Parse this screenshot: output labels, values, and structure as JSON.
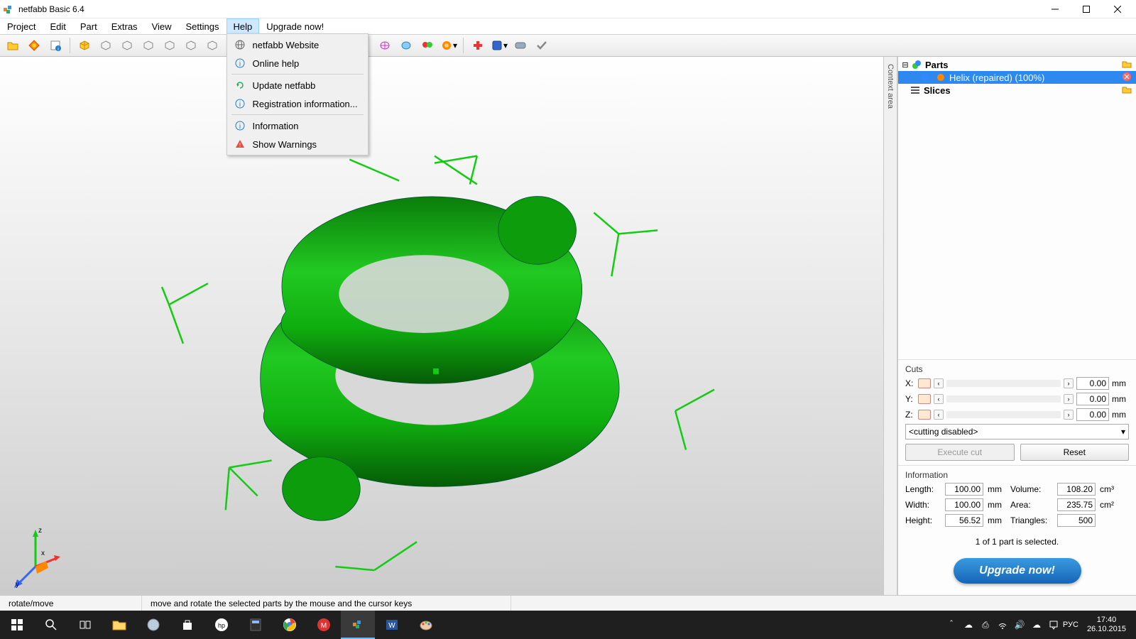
{
  "title": "netfabb Basic 6.4",
  "menus": [
    "Project",
    "Edit",
    "Part",
    "Extras",
    "View",
    "Settings",
    "Help",
    "Upgrade now!"
  ],
  "help_menu": [
    {
      "icon": "globe",
      "label": "netfabb Website"
    },
    {
      "icon": "info",
      "label": "Online help"
    },
    {
      "sep": true
    },
    {
      "icon": "refresh",
      "label": "Update netfabb"
    },
    {
      "icon": "info",
      "label": "Registration information..."
    },
    {
      "sep": true
    },
    {
      "icon": "info",
      "label": "Information"
    },
    {
      "icon": "warn",
      "label": "Show Warnings"
    }
  ],
  "tree": {
    "root": "Parts",
    "child": "Helix (repaired) (100%)",
    "slices": "Slices"
  },
  "context_tab": "Context area",
  "cuts": {
    "title": "Cuts",
    "axes": [
      "X:",
      "Y:",
      "Z:"
    ],
    "values": [
      "0.00",
      "0.00",
      "0.00"
    ],
    "unit": "mm",
    "mode": "<cutting disabled>",
    "execute": "Execute cut",
    "reset": "Reset"
  },
  "info": {
    "title": "Information",
    "length_l": "Length:",
    "length_v": "100.00",
    "length_u": "mm",
    "width_l": "Width:",
    "width_v": "100.00",
    "width_u": "mm",
    "height_l": "Height:",
    "height_v": "56.52",
    "height_u": "mm",
    "volume_l": "Volume:",
    "volume_v": "108.20",
    "volume_u": "cm³",
    "area_l": "Area:",
    "area_v": "235.75",
    "area_u": "cm²",
    "tri_l": "Triangles:",
    "tri_v": "500",
    "tri_u": ""
  },
  "selection_status": "1 of 1 part is selected.",
  "upgrade": "Upgrade now!",
  "status": {
    "mode": "rotate/move",
    "hint": "move and rotate the selected parts by the mouse and the cursor keys"
  },
  "axes": {
    "x": "x",
    "y": "y",
    "z": "z"
  },
  "clock": {
    "time": "17:40",
    "date": "26.10.2015"
  },
  "lang": "РУС"
}
